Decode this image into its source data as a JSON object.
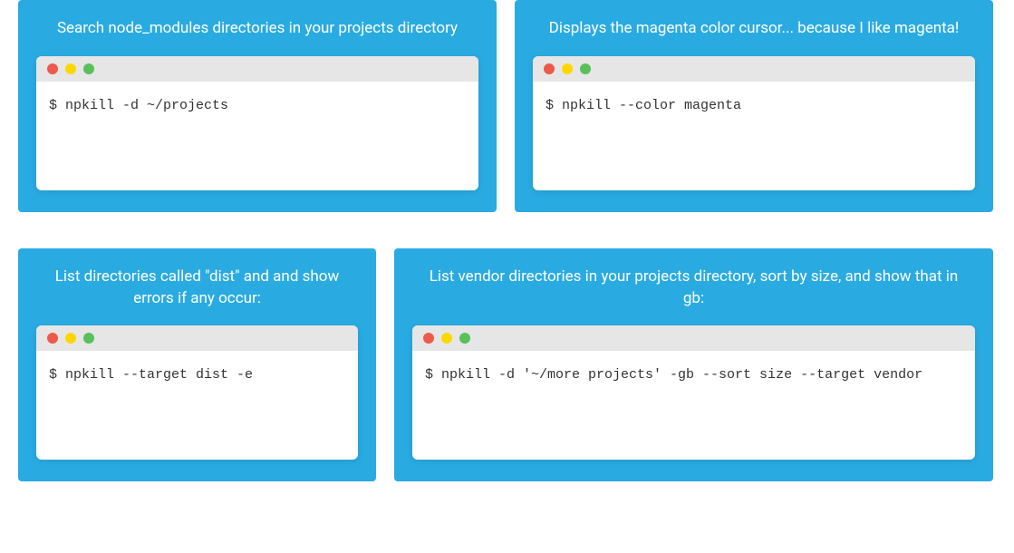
{
  "cards": [
    {
      "title": "Search node_modules directories in your projects directory",
      "command": "$ npkill -d ~/projects"
    },
    {
      "title": "Displays the magenta color cursor... because I like magenta!",
      "command": "$ npkill --color magenta"
    },
    {
      "title": "List directories called \"dist\" and and show errors if any occur:",
      "command": "$ npkill --target dist -e"
    },
    {
      "title": "List vendor directories in your projects directory, sort by size, and show that in gb:",
      "command": "$ npkill -d '~/more projects' -gb --sort size --target vendor"
    }
  ]
}
